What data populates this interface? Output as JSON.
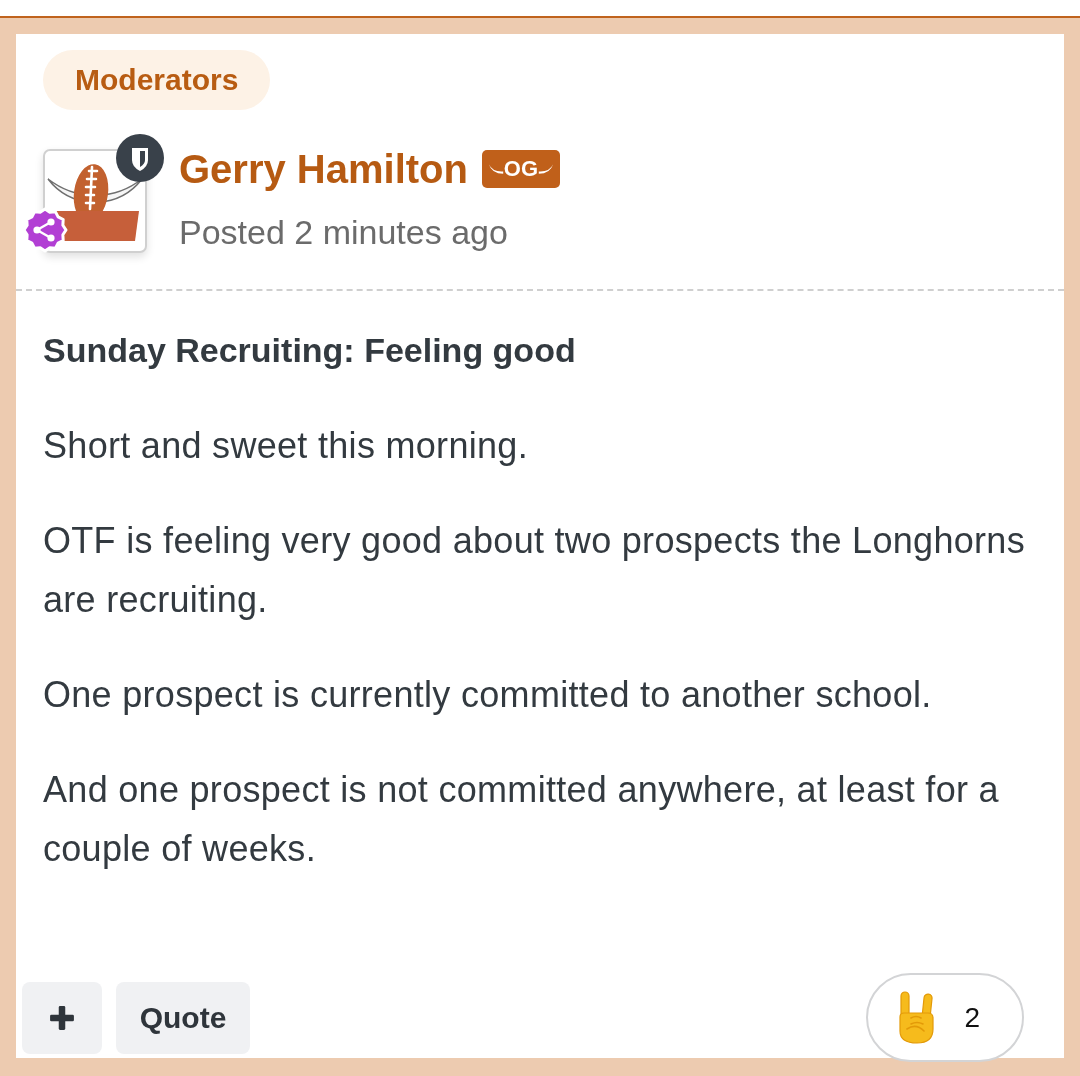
{
  "post": {
    "group": "Moderators",
    "author": {
      "name": "Gerry Hamilton",
      "rank_badge": "OG",
      "posted": "Posted 2 minutes ago"
    },
    "title": "Sunday Recruiting: Feeling good",
    "paragraphs": [
      "Short and sweet this morning.",
      "OTF is feeling very good about two prospects the Longhorns are recruiting.",
      "One prospect is currently committed to another school.",
      "And one prospect is not committed anywhere, at least for a couple of weeks."
    ],
    "actions": [
      {
        "kind": "add"
      },
      {
        "kind": "quote",
        "label": "Quote"
      }
    ],
    "reaction": {
      "count": "2"
    }
  }
}
